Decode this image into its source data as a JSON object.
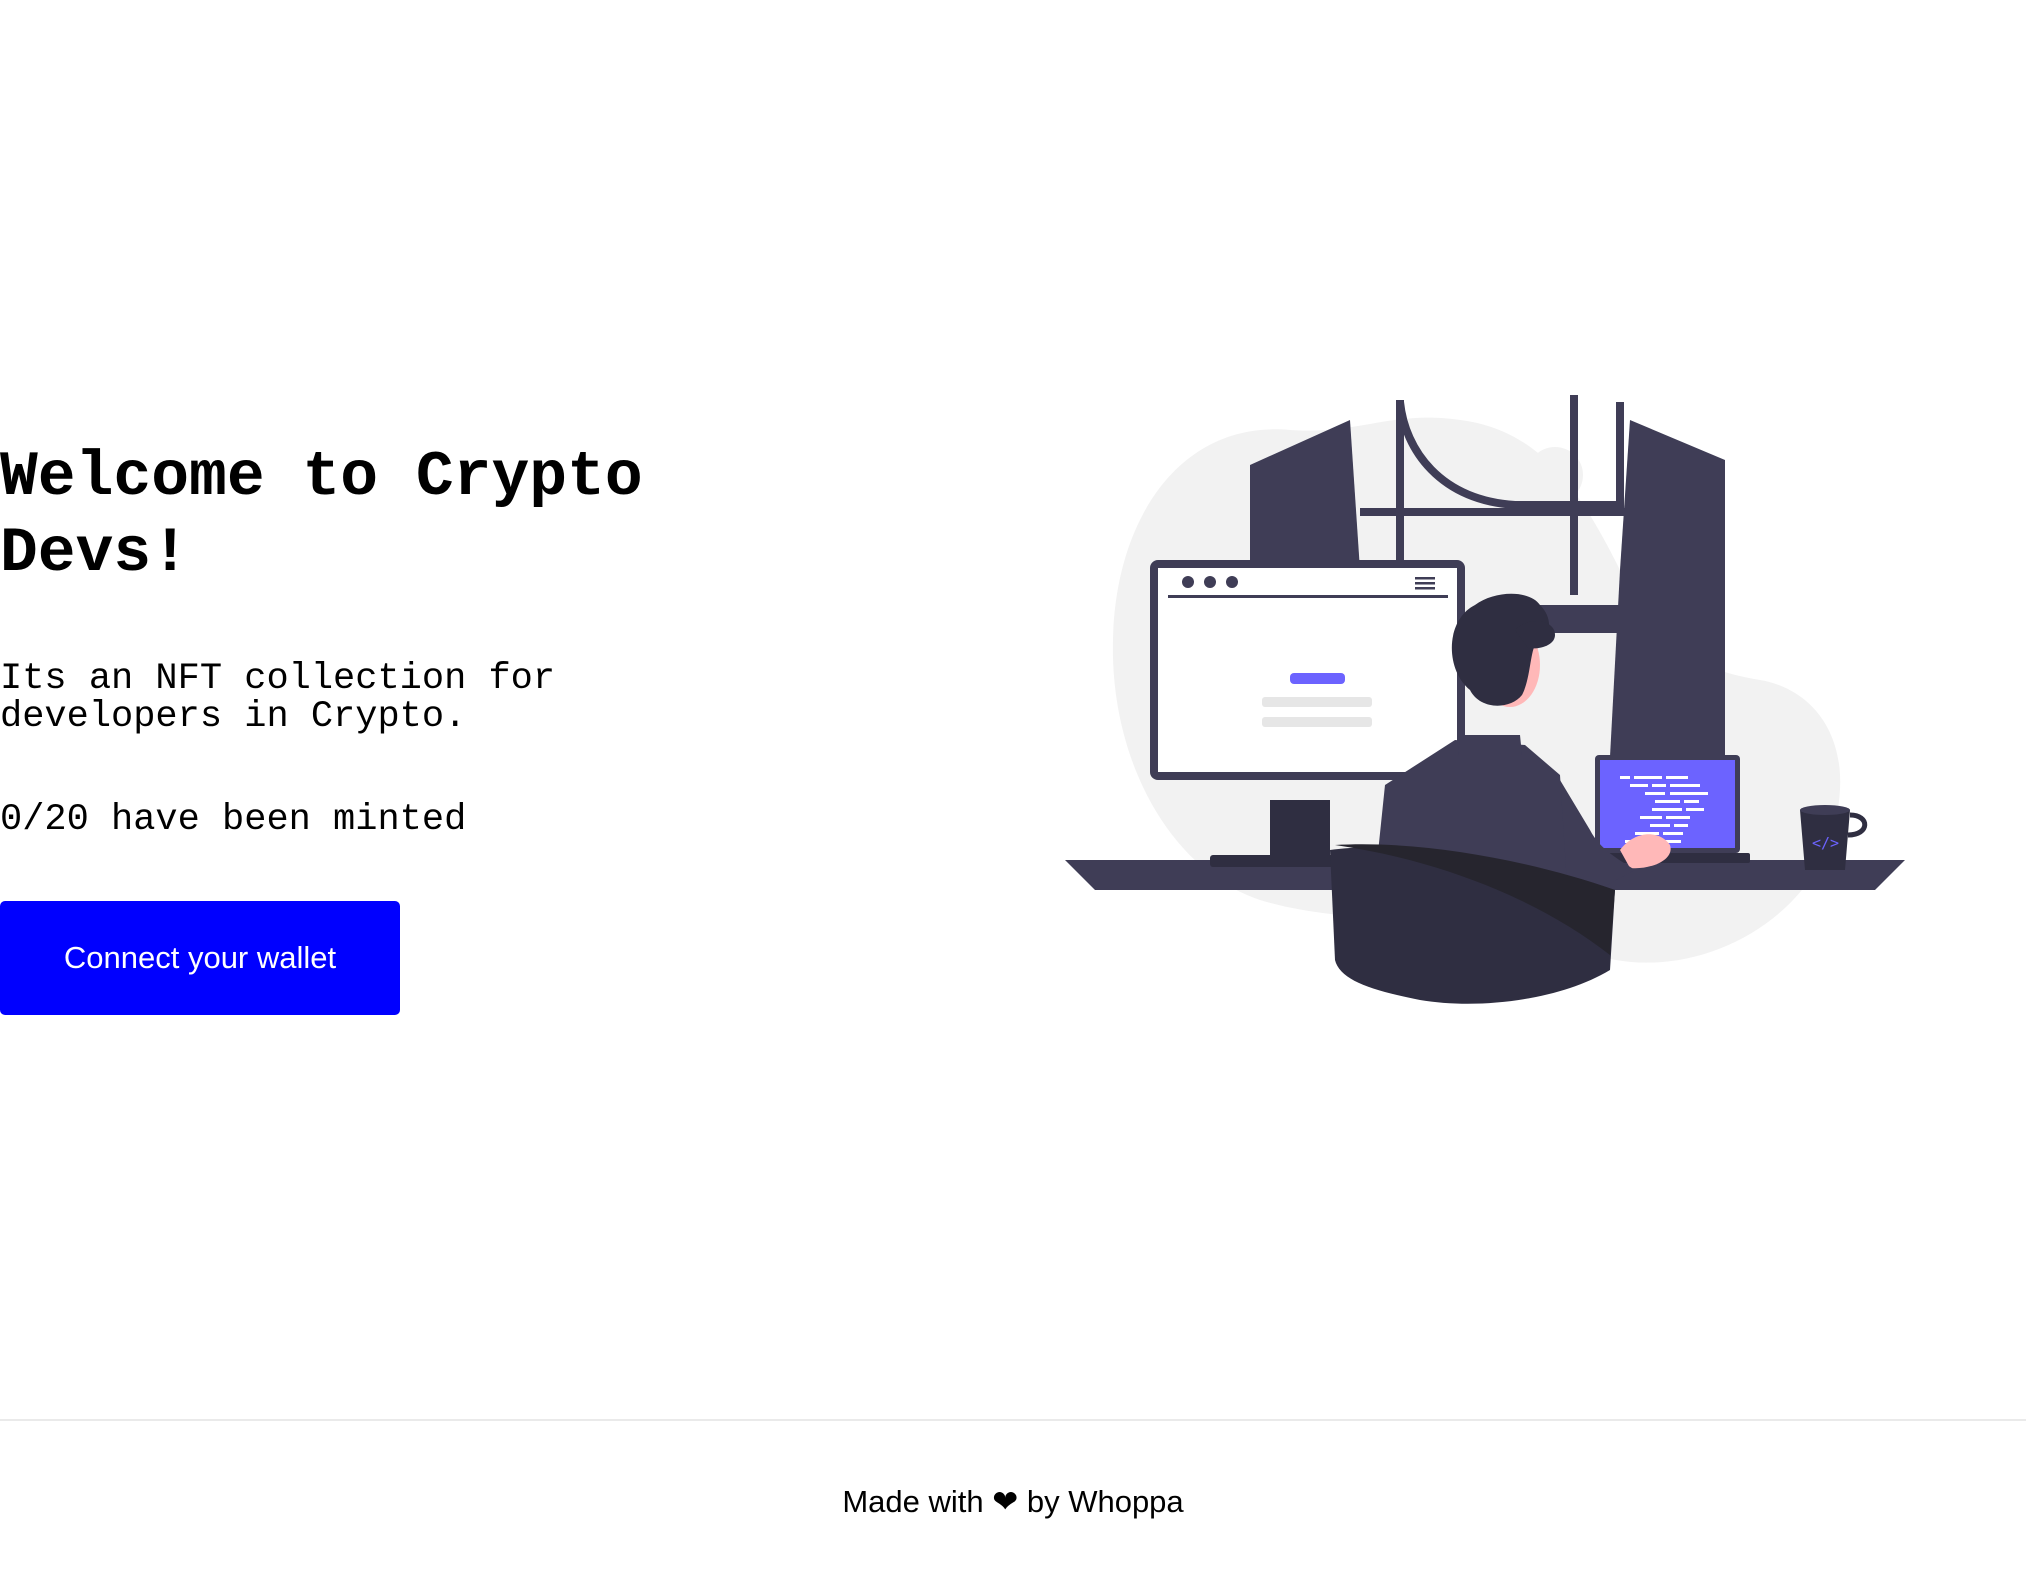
{
  "hero": {
    "title": "Welcome to Crypto Devs!",
    "description": "Its an NFT collection for developers in Crypto.",
    "minted_text": "0/20 have been minted",
    "connect_button_label": "Connect your wallet"
  },
  "illustration": {
    "icon": "developer-at-desk-illustration"
  },
  "footer": {
    "made_with": "Made with",
    "heart": "❤",
    "by": "by Whoppa"
  },
  "colors": {
    "accent": "#0000ff",
    "illustration_dark": "#3f3d56",
    "illustration_purple": "#6c63ff",
    "illustration_bg": "#f2f2f2"
  }
}
